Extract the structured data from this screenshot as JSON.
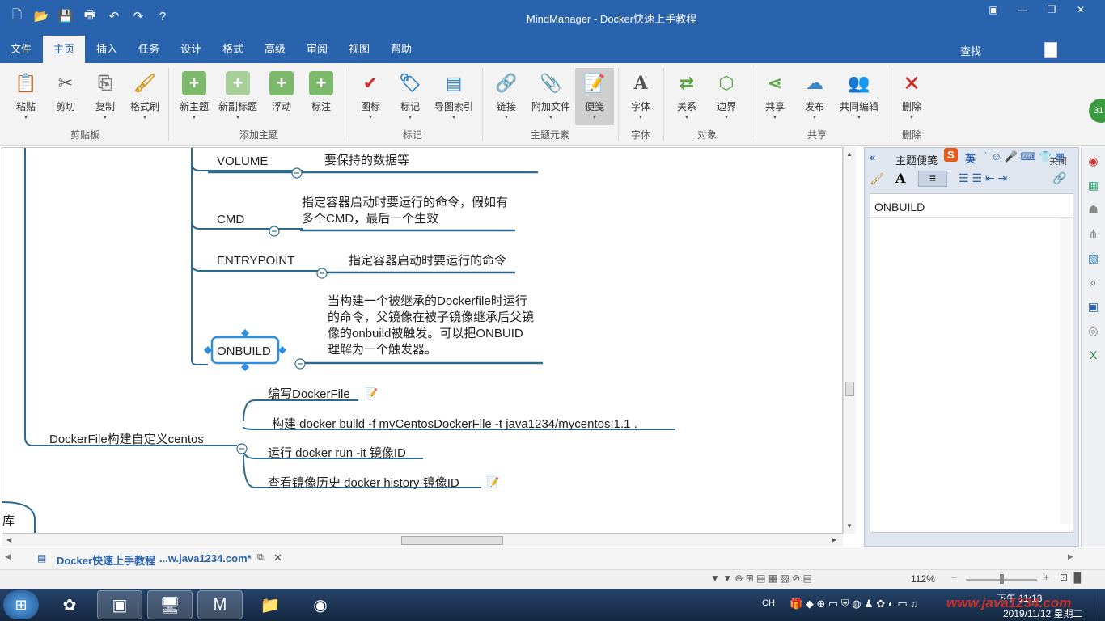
{
  "window": {
    "title": "MindManager - Docker快速上手教程"
  },
  "qat": {
    "icons": [
      "new-icon",
      "open-icon",
      "save-icon",
      "print-icon",
      "undo-icon",
      "redo-icon",
      "help-icon"
    ]
  },
  "menu": {
    "tabs": [
      "文件",
      "主页",
      "插入",
      "任务",
      "设计",
      "格式",
      "高级",
      "审阅",
      "视图",
      "帮助"
    ],
    "active": "主页",
    "find": "查找"
  },
  "ribbon": {
    "buttons": {
      "paste": "粘贴",
      "cut": "剪切",
      "copy": "复制",
      "format_painter": "格式刷",
      "new_topic": "新主题",
      "new_subtopic": "新副标题",
      "floating": "浮动",
      "callout": "标注",
      "icons": "图标",
      "tags": "标记",
      "map_index": "导图索引",
      "link": "链接",
      "attach": "附加文件",
      "notes": "便笺",
      "font": "字体",
      "relationship": "关系",
      "boundary": "边界",
      "share": "共享",
      "publish": "发布",
      "co_edit": "共同编辑",
      "delete": "删除"
    },
    "groups": {
      "clipboard": "剪贴板",
      "add_topic": "添加主题",
      "markers": "标记",
      "topic_elements": "主题元素",
      "font": "字体",
      "objects": "对象",
      "share": "共享",
      "delete": "删除"
    }
  },
  "map": {
    "topics": {
      "volume": "VOLUME",
      "volume_note": "要保持的数据等",
      "cmd": "CMD",
      "cmd_note_1": "指定容器启动时要运行的命令，假如有",
      "cmd_note_2": "多个CMD，最后一个生效",
      "entrypoint": "ENTRYPOINT",
      "entrypoint_note": "指定容器启动时要运行的命令",
      "onbuild": "ONBUILD",
      "onbuild_note_1": "当构建一个被继承的Dockerfile时运行",
      "onbuild_note_2": "的命令，父镜像在被子镜像继承后父镜",
      "onbuild_note_3": "像的onbuild被触发。可以把ONBUID",
      "onbuild_note_4": "理解为一个触发器。",
      "main": "DockerFile构建自定义centos",
      "sub1": "编写DockerFile",
      "sub2": "构建 docker build -f myCentosDockerFile -t java1234/mycentos:1.1 .",
      "sub3": "运行 docker run -it 镜像ID",
      "sub4": "查看镜像历史  docker history 镜像ID",
      "partial": "库"
    }
  },
  "notes_panel": {
    "title": "主题便笺",
    "close": "关闭",
    "content": "ONBUILD",
    "ime": "英"
  },
  "doctabs": {
    "tab1": "Docker快速上手教程",
    "tab2": "...w.java1234.com*"
  },
  "status": {
    "zoom": "112%"
  },
  "taskbar": {
    "lang": "CH",
    "time": "下午 11:13",
    "date": "2019/11/12 星期二",
    "watermark": "www.java1234.com"
  }
}
